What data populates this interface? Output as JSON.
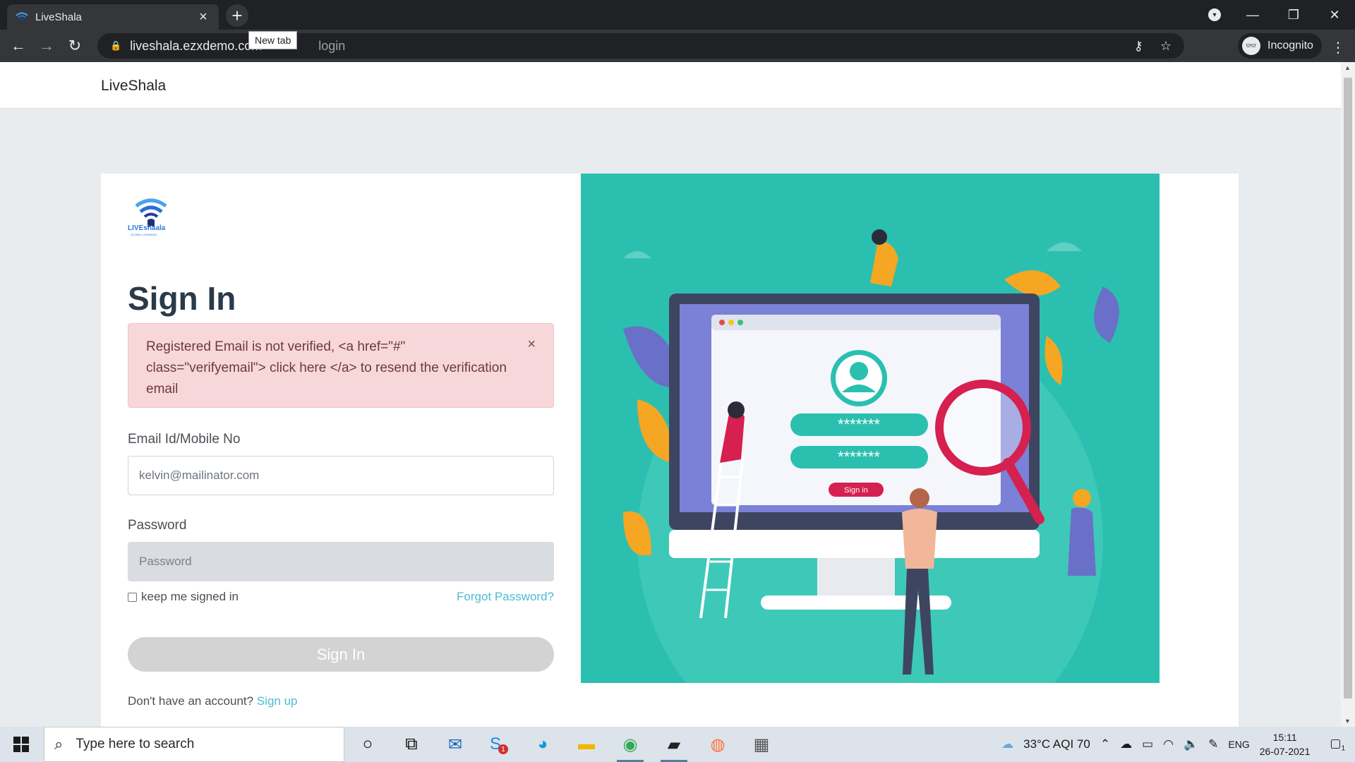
{
  "browser": {
    "tab_title": "LiveShala",
    "tab_close": "×",
    "new_tab_tooltip": "New tab",
    "url_host": "liveshala.ezxdemo.com",
    "url_rest": "login",
    "profile_label": "Incognito"
  },
  "site": {
    "brand": "LiveShala",
    "logo_text": "LIVEshaala",
    "logo_sub": "GLOBAL LEARNING"
  },
  "signin": {
    "title": "Sign In",
    "alert_text": "Registered Email is not verified, <a href=\"#\" class=\"verifyemail\"> click here </a> to resend the verification email",
    "alert_close": "×",
    "email_label": "Email Id/Mobile No",
    "email_value": "kelvin@mailinator.com",
    "password_label": "Password",
    "password_placeholder": "Password",
    "remember_label": "keep me signed in",
    "forgot_link": "Forgot Password?",
    "submit_label": "Sign In",
    "signup_prompt": "Don't have an account?",
    "signup_link": "Sign up"
  },
  "illustration": {
    "password_mask_1": "*******",
    "password_mask_2": "*******",
    "button_label": "Sign in"
  },
  "taskbar": {
    "search_placeholder": "Type here to search",
    "weather": "33°C AQI 70",
    "language": "ENG",
    "time": "15:11",
    "date": "26-07-2021",
    "skype_badge": "1",
    "notification_count": "1"
  },
  "colors": {
    "illustration_bg": "#2bbfb0",
    "alert_bg": "#f8d7da",
    "link": "#4dbbd3"
  }
}
